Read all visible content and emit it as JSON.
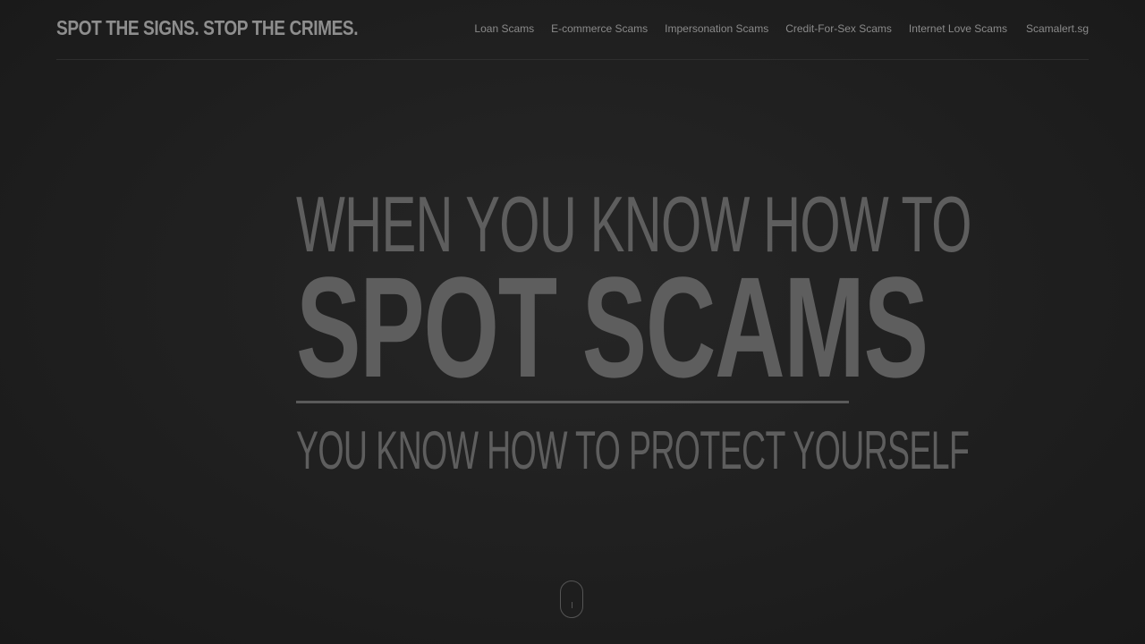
{
  "header": {
    "logo_text": "SPOT THE SIGNS. STOP THE CRIMES.",
    "nav": [
      {
        "label": "Loan Scams"
      },
      {
        "label": "E-commerce Scams"
      },
      {
        "label": "Impersonation Scams"
      },
      {
        "label": "Credit-For-Sex Scams"
      },
      {
        "label": "Internet Love Scams"
      },
      {
        "label": "Scamalert.sg"
      }
    ]
  },
  "hero": {
    "line1": "WHEN YOU KNOW HOW TO",
    "line2": "SPOT SCAMS",
    "line3": "YOU KNOW HOW TO PROTECT YOURSELF"
  },
  "scroll_indicator": {
    "icon": "mouse-scroll-icon"
  },
  "colors": {
    "background": "#1f1f1f",
    "text_muted": "#5e5e5e",
    "nav_text": "#8a8a8a"
  }
}
